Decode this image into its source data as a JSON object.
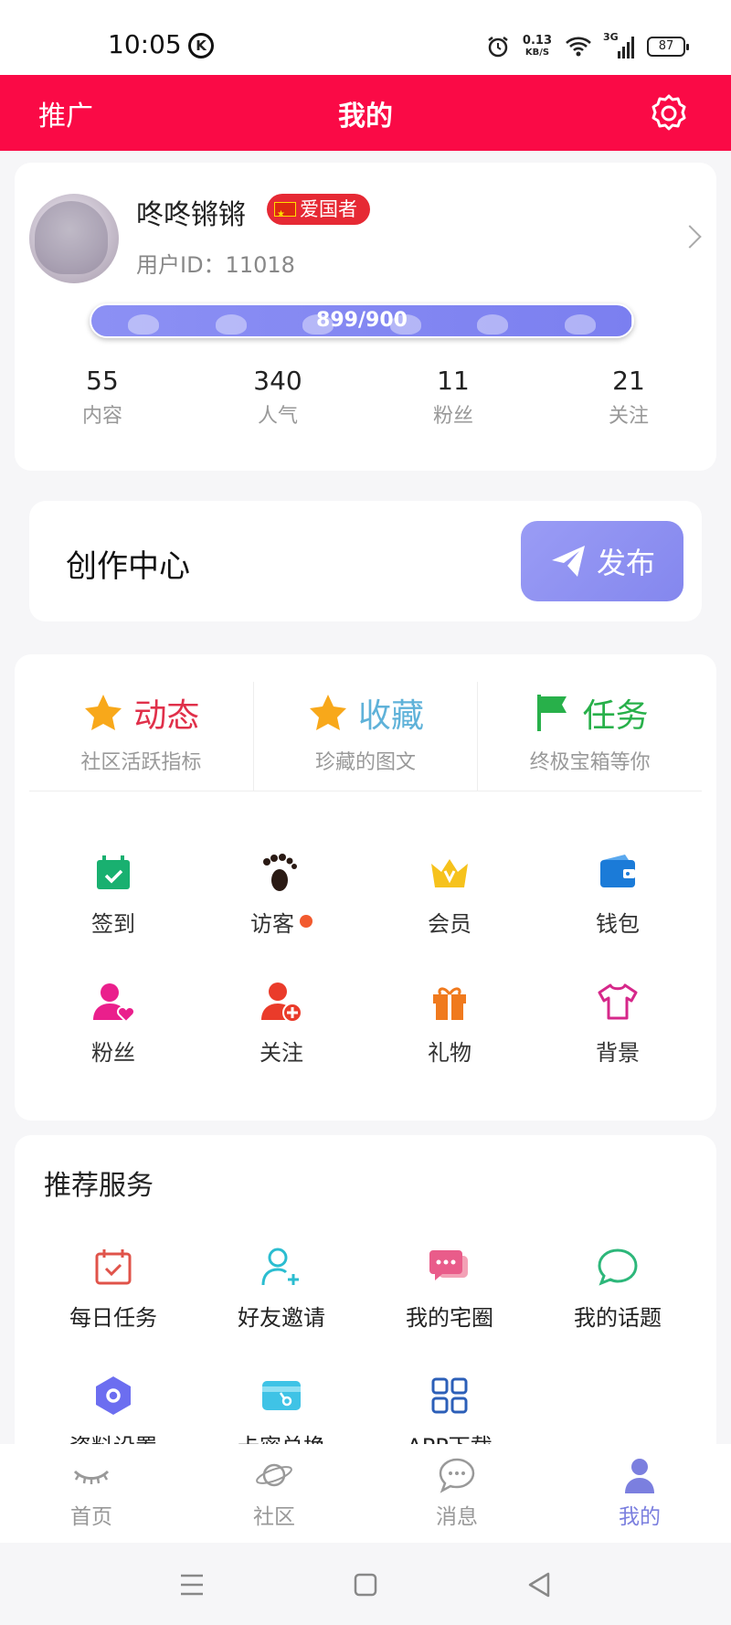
{
  "status_bar": {
    "time": "10:05",
    "k_icon": "K",
    "speed_value": "0.13",
    "speed_unit": "KB/S",
    "network": "3G",
    "battery": "87"
  },
  "header": {
    "left_label": "推广",
    "title": "我的",
    "settings_icon": "gear-icon"
  },
  "profile": {
    "username": "咚咚锵锵",
    "badge": "爱国者",
    "user_id": "用户ID：11018",
    "level_text": "899/900",
    "level_progress": 0.999,
    "stats": [
      {
        "value": "55",
        "label": "内容"
      },
      {
        "value": "340",
        "label": "人气"
      },
      {
        "value": "11",
        "label": "粉丝"
      },
      {
        "value": "21",
        "label": "关注"
      }
    ]
  },
  "creation": {
    "title": "创作中心",
    "publish_label": "发布"
  },
  "top_tabs": [
    {
      "title": "动态",
      "subtitle": "社区活跃指标",
      "icon": "star-icon",
      "color": "#e0304a"
    },
    {
      "title": "收藏",
      "subtitle": "珍藏的图文",
      "icon": "star-icon",
      "color": "#5fb2d9"
    },
    {
      "title": "任务",
      "subtitle": "终极宝箱等你",
      "icon": "flag-icon",
      "color": "#28b04a"
    }
  ],
  "features": [
    {
      "label": "签到",
      "icon": "calendar-check-icon"
    },
    {
      "label": "访客",
      "icon": "footprints-icon"
    },
    {
      "label": "会员",
      "icon": "crown-icon"
    },
    {
      "label": "钱包",
      "icon": "wallet-icon"
    },
    {
      "label": "粉丝",
      "icon": "user-heart-icon"
    },
    {
      "label": "关注",
      "icon": "user-plus-icon"
    },
    {
      "label": "礼物",
      "icon": "gift-icon"
    },
    {
      "label": "背景",
      "icon": "tshirt-icon"
    }
  ],
  "services": {
    "title": "推荐服务",
    "items": [
      {
        "label": "每日任务",
        "icon": "calendar-icon"
      },
      {
        "label": "好友邀请",
        "icon": "invite-icon"
      },
      {
        "label": "我的宅圈",
        "icon": "chat-bubbles-icon"
      },
      {
        "label": "我的话题",
        "icon": "speech-bubble-icon"
      },
      {
        "label": "资料设置",
        "icon": "hexagon-icon"
      },
      {
        "label": "卡密兑换",
        "icon": "card-icon"
      },
      {
        "label": "APP下载",
        "icon": "grid-icon"
      }
    ]
  },
  "bottom_nav": [
    {
      "label": "首页",
      "icon": "eye-lashes-icon"
    },
    {
      "label": "社区",
      "icon": "planet-icon"
    },
    {
      "label": "消息",
      "icon": "message-icon"
    },
    {
      "label": "我的",
      "icon": "person-icon",
      "active": true
    }
  ],
  "colors": {
    "header": "#fa0a46",
    "accent": "#7b7fdf"
  }
}
